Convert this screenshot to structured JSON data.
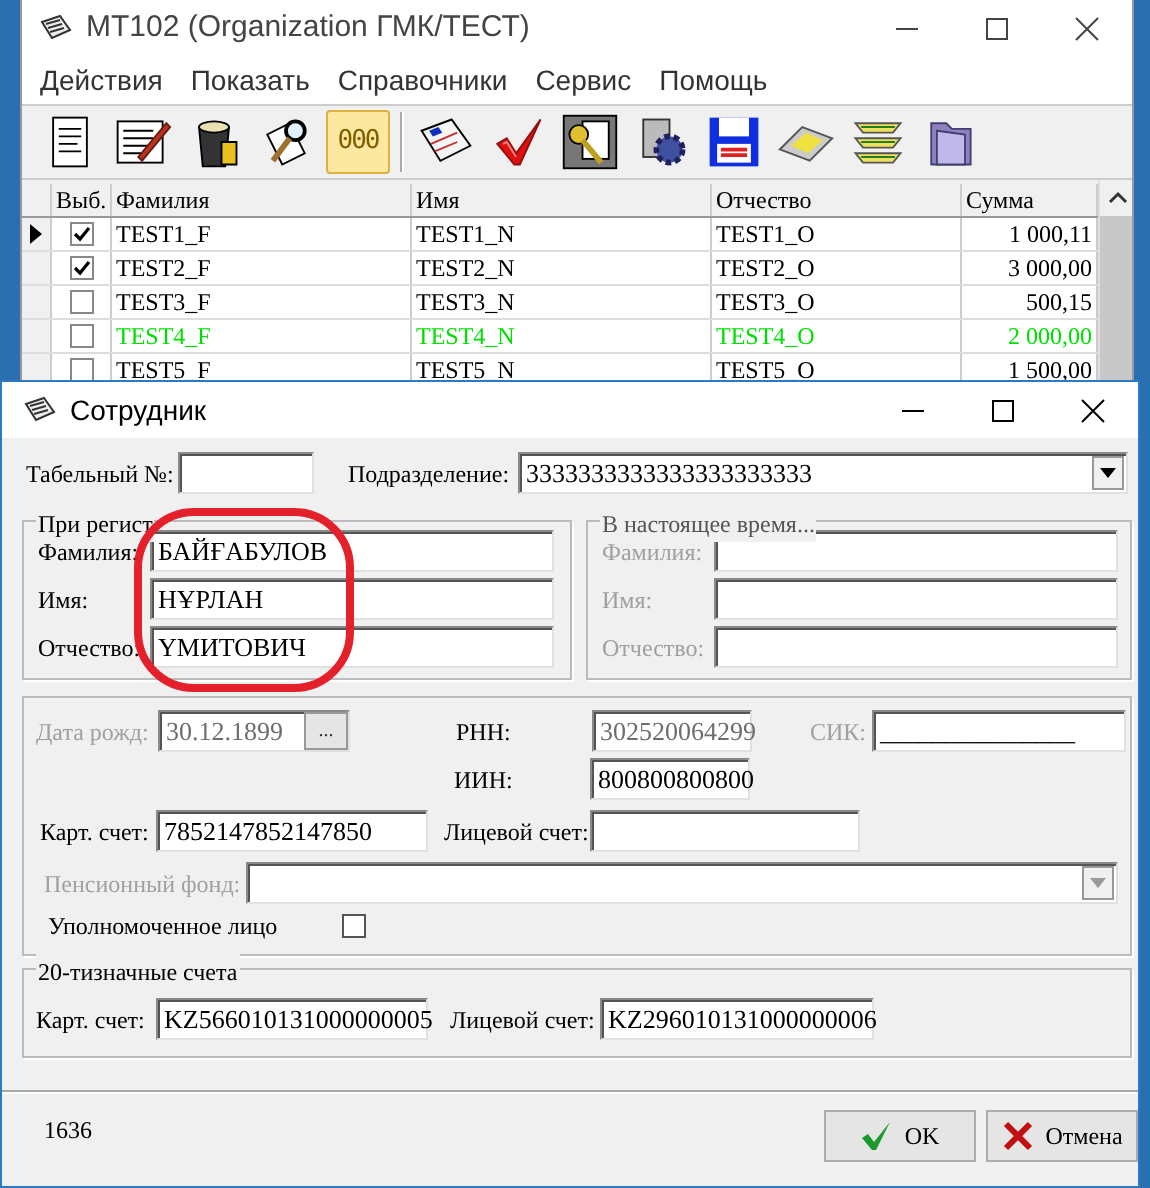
{
  "main_window": {
    "title": "MT102 (Organization ГМК/ТЕСТ)",
    "menu": [
      {
        "label": "Действия"
      },
      {
        "label": "Показать"
      },
      {
        "label": "Справочники"
      },
      {
        "label": "Сервис"
      },
      {
        "label": "Помощь"
      }
    ],
    "toolbar": [
      [
        {
          "kind": "document",
          "pressed": false
        },
        {
          "kind": "edit",
          "pressed": false
        },
        {
          "kind": "trash",
          "pressed": false
        },
        {
          "kind": "search",
          "pressed": false
        },
        {
          "kind": "counter",
          "label": "000",
          "pressed": true
        }
      ],
      [
        {
          "kind": "newspaper",
          "pressed": false
        },
        {
          "kind": "check",
          "pressed": false
        },
        {
          "kind": "key",
          "pressed": false
        },
        {
          "kind": "gear",
          "pressed": false
        },
        {
          "kind": "save",
          "pressed": false
        },
        {
          "kind": "printer",
          "pressed": false
        },
        {
          "kind": "layers",
          "pressed": false
        },
        {
          "kind": "folder",
          "pressed": false
        }
      ]
    ],
    "table": {
      "select_column": "Выб.",
      "columns": [
        "Фамилия",
        "Имя",
        "Отчество",
        "Сумма"
      ],
      "rows": [
        {
          "current": true,
          "checked": true,
          "color": "#000000",
          "cells": [
            "TEST1_F",
            "TEST1_N",
            "TEST1_O",
            "1 000,11"
          ]
        },
        {
          "current": false,
          "checked": true,
          "color": "#000000",
          "cells": [
            "TEST2_F",
            "TEST2_N",
            "TEST2_O",
            "3 000,00"
          ]
        },
        {
          "current": false,
          "checked": false,
          "color": "#000000",
          "cells": [
            "TEST3_F",
            "TEST3_N",
            "TEST3_O",
            "500,15"
          ]
        },
        {
          "current": false,
          "checked": false,
          "color": "#00e000",
          "cells": [
            "TEST4_F",
            "TEST4_N",
            "TEST4_O",
            "2 000,00"
          ]
        },
        {
          "current": false,
          "checked": false,
          "color": "#000000",
          "cells": [
            "TEST5_F",
            "TEST5_N",
            "TEST5_O",
            "1 500,00"
          ]
        }
      ]
    }
  },
  "dialog": {
    "title": "Сотрудник",
    "tab_number": {
      "label": "Табельный №:"
    },
    "department": {
      "label": "Подразделение:",
      "value": "3333333333333333333333"
    },
    "registration_group": {
      "title": "При регист",
      "disabled": false,
      "fields": [
        {
          "label": "Фамилия:",
          "value": "БАЙҒАБУЛОВ"
        },
        {
          "label": "Имя:",
          "value": "НҰРЛАН"
        },
        {
          "label": "Отчество:",
          "value": "ҮМИТОВИЧ"
        }
      ]
    },
    "current_group": {
      "title": "В настоящее время...",
      "disabled": true,
      "fields": [
        {
          "label": "Фамилия:"
        },
        {
          "label": "Имя:"
        },
        {
          "label": "Отчество:"
        }
      ]
    },
    "birth_date": {
      "label": "Дата рожд:",
      "value": "30.12.1899",
      "button": "...",
      "disabled": true
    },
    "rnn": {
      "label": "РНН:",
      "value": "302520064299",
      "disabled": false,
      "read_only": true
    },
    "sik": {
      "label": "СИК:",
      "value": "_______________",
      "disabled": true
    },
    "iin": {
      "label": "ИИН:",
      "value": "800800800800",
      "disabled": false,
      "read_only": false
    },
    "card_account": {
      "label": "Карт. счет:",
      "value": "7852147852147850"
    },
    "personal_account": {
      "label": "Лицевой счет:"
    },
    "pension_fund": {
      "label": "Пенсионный фонд:",
      "disabled": true
    },
    "authorized": {
      "label": "Уполномоченное лицо",
      "checked": false
    },
    "accounts20": {
      "title": "20-тизначные счета",
      "card_account": {
        "label": "Карт. счет:",
        "value": "KZ566010131000000005"
      },
      "personal_account": {
        "label": "Лицевой счет:",
        "value": "KZ296010131000000006"
      }
    },
    "record_number": "1636",
    "buttons": [
      {
        "kind": "ok",
        "label": "OK"
      },
      {
        "kind": "cancel",
        "label": "Отмена"
      }
    ]
  }
}
